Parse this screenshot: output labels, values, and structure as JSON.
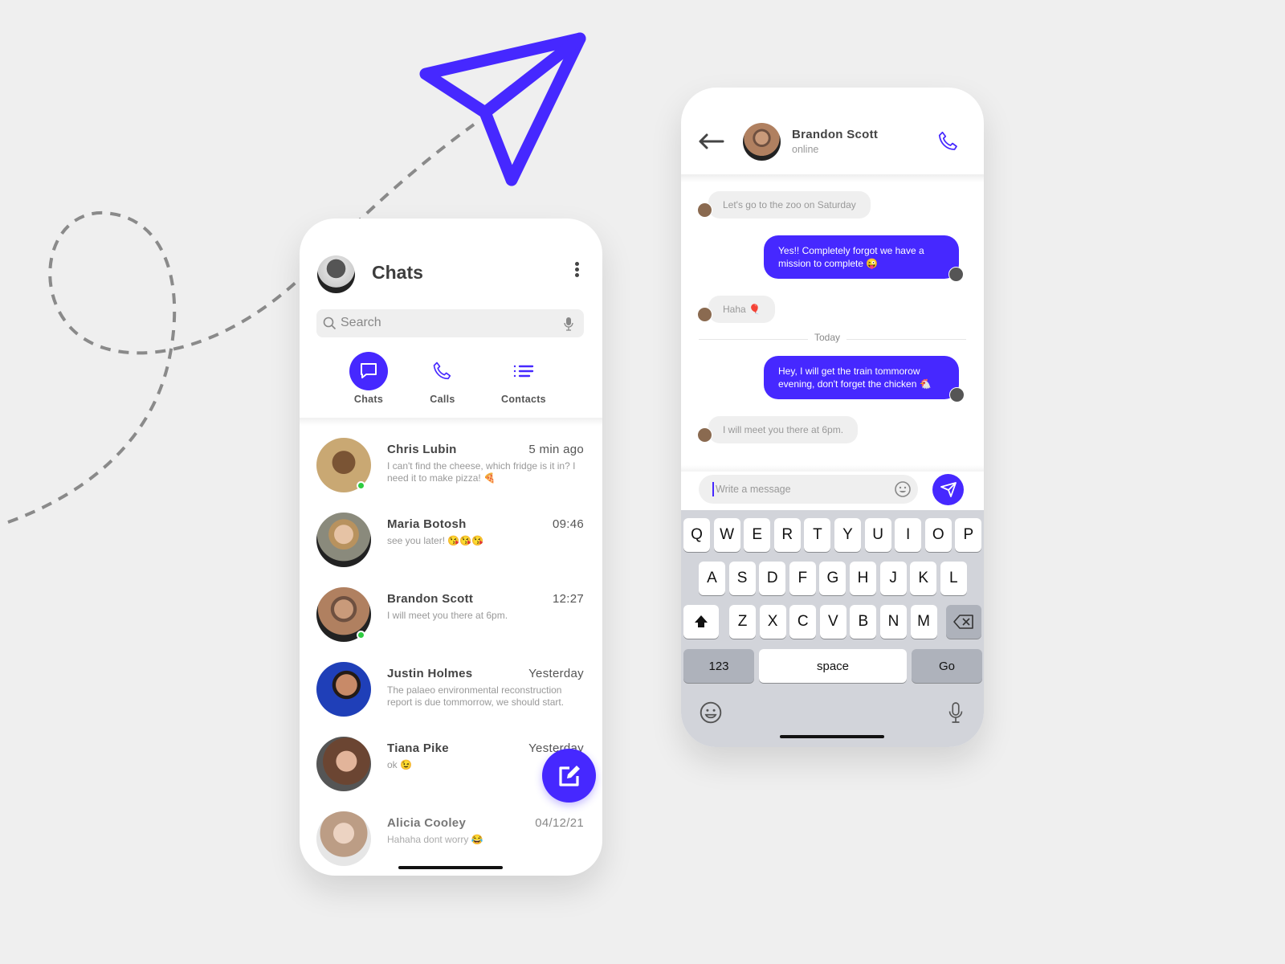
{
  "colors": {
    "accent": "#4628ff",
    "online": "#2ecc40",
    "background": "#efefef"
  },
  "chats_screen": {
    "title": "Chats",
    "search_placeholder": "Search",
    "tabs": [
      {
        "label": "Chats",
        "icon": "chat-bubble-icon",
        "active": true
      },
      {
        "label": "Calls",
        "icon": "phone-icon"
      },
      {
        "label": "Contacts",
        "icon": "list-icon"
      }
    ],
    "conversations": [
      {
        "name": "Chris Lubin",
        "time": "5 min ago",
        "message": "I can't find the cheese, which fridge is it in? I need it to make pizza! 🍕",
        "online": true
      },
      {
        "name": "Maria Botosh",
        "time": "09:46",
        "message": "see you later! 😘😘😘",
        "online": false
      },
      {
        "name": "Brandon Scott",
        "time": "12:27",
        "message": "I will meet you there at 6pm.",
        "online": true
      },
      {
        "name": "Justin Holmes",
        "time": "Yesterday",
        "message": "The palaeo environmental reconstruction report is due tommorrow, we should start.",
        "online": false
      },
      {
        "name": "Tiana Pike",
        "time": "Yesterday",
        "message": "ok 😉",
        "online": false
      },
      {
        "name": "Alicia Cooley",
        "time": "04/12/21",
        "message": "Hahaha dont worry 😂",
        "online": false
      }
    ]
  },
  "chat_screen": {
    "contact_name": "Brandon Scott",
    "status": "online",
    "messages": [
      {
        "direction": "in",
        "text": "Let's go to the zoo on Saturday"
      },
      {
        "direction": "out",
        "text": "Yes!! Completely forgot we have a mission to complete 😜"
      },
      {
        "direction": "in",
        "text": "Haha 🎈"
      },
      {
        "direction": "divider",
        "text": "Today"
      },
      {
        "direction": "out",
        "text": "Hey, I will get the train tommorow evening, don't forget the chicken 🐔"
      },
      {
        "direction": "in",
        "text": "I will meet you there at 6pm."
      }
    ],
    "input_placeholder": "Write a message",
    "keyboard": {
      "row1": [
        "Q",
        "W",
        "E",
        "R",
        "T",
        "Y",
        "U",
        "I",
        "O",
        "P"
      ],
      "row2": [
        "A",
        "S",
        "D",
        "F",
        "G",
        "H",
        "J",
        "K",
        "L"
      ],
      "row3": [
        "Z",
        "X",
        "C",
        "V",
        "B",
        "N",
        "M"
      ],
      "numbers": "123",
      "space": "space",
      "go": "Go"
    }
  }
}
